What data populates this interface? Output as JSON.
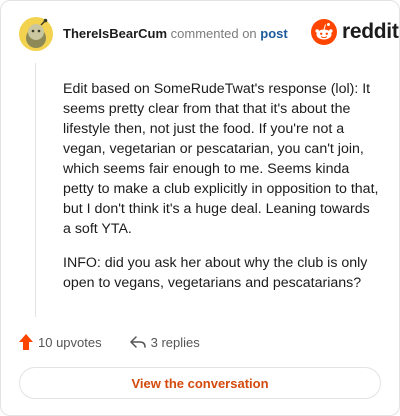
{
  "comment": {
    "author": "ThereIsBearCum",
    "action_text": "commented on",
    "target_link": "post",
    "paragraphs": [
      "Edit based on SomeRudeTwat's response (lol): It seems pretty clear from that that it's about the lifestyle then, not just the food. If you're not a vegan, vegetarian or pescatarian, you can't join, which seems fair enough to me. Seems kinda petty to make a club explicitly in opposition to that, but I don't think it's a huge deal. Leaning towards a soft YTA.",
      "INFO: did you ask her about why the club is only open to vegans, vegetarians and pescatarians?"
    ]
  },
  "brand": {
    "name": "reddit",
    "icon": "reddit-logo-icon",
    "color": "#ff4500"
  },
  "footer": {
    "upvotes_label": "10 upvotes",
    "upvote_icon": "upvote-arrow-icon",
    "upvote_color": "#ff4500",
    "replies_label": "3 replies",
    "reply_icon": "reply-arrow-icon"
  },
  "cta": {
    "label": "View the conversation",
    "color": "#d34a0c"
  }
}
